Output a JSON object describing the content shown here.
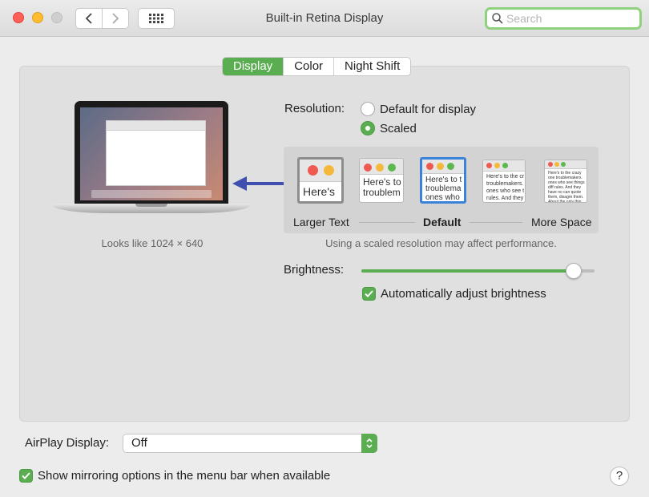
{
  "window": {
    "title": "Built-in Retina Display"
  },
  "search": {
    "placeholder": "Search"
  },
  "tabs": [
    {
      "label": "Display",
      "active": true
    },
    {
      "label": "Color",
      "active": false
    },
    {
      "label": "Night Shift",
      "active": false
    }
  ],
  "display": {
    "looks_like": "Looks like 1024 × 640"
  },
  "resolution": {
    "label": "Resolution:",
    "options": [
      {
        "label": "Default for display",
        "selected": false
      },
      {
        "label": "Scaled",
        "selected": true
      }
    ]
  },
  "scale": {
    "thumbs": [
      {
        "text": "Here's"
      },
      {
        "text": "Here's to troublem"
      },
      {
        "text": "Here's to t troublema ones who"
      },
      {
        "text": "Here's to the cr troublemakers. ones who see t rules. And they"
      },
      {
        "text": "Here's to the crazy one troublemakers. ones who see things diff rules. And they have no can quote them, disagre them. About the only thin Because they change thin"
      }
    ],
    "labels": {
      "left": "Larger Text",
      "center": "Default",
      "right": "More Space"
    },
    "note": "Using a scaled resolution may affect performance."
  },
  "brightness": {
    "label": "Brightness:",
    "level": 0.91,
    "auto_label": "Automatically adjust brightness",
    "auto_checked": true
  },
  "airplay": {
    "label": "AirPlay Display:",
    "value": "Off"
  },
  "mirroring": {
    "label": "Show mirroring options in the menu bar when available",
    "checked": true
  },
  "help": {
    "label": "?"
  },
  "colors": {
    "accent": "#5aae51",
    "selection": "#3b82d9",
    "arrow": "#3e4fb0"
  }
}
